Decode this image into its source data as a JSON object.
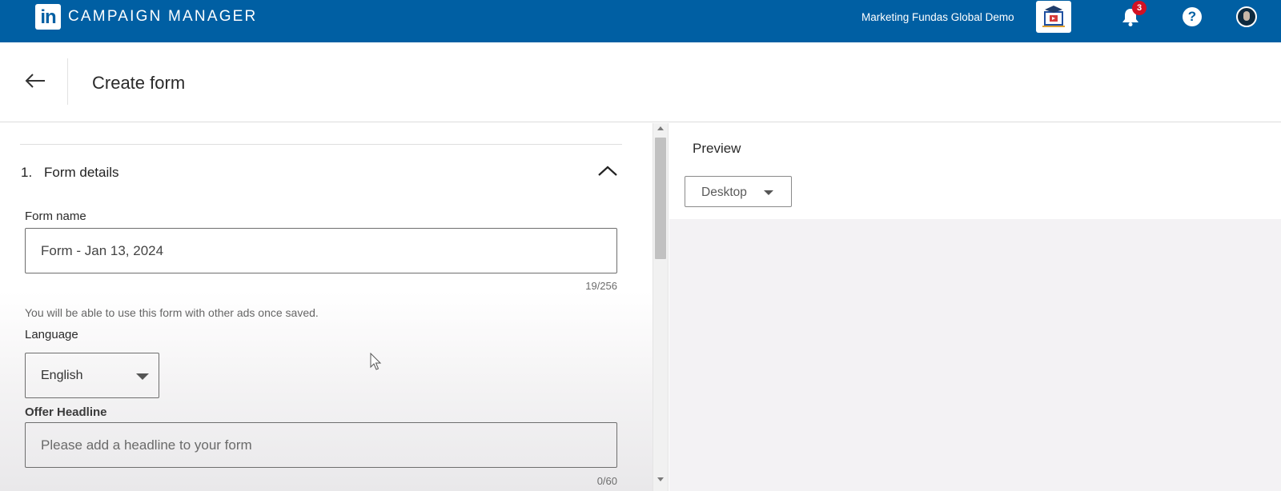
{
  "topbar": {
    "logo_text": "in",
    "brand": "CAMPAIGN MANAGER",
    "account_name": "Marketing Fundas Global Demo",
    "notification_count": "3",
    "help_glyph": "?",
    "brand_color": "#005fa3",
    "badge_color": "#d11124"
  },
  "header": {
    "title": "Create form"
  },
  "form": {
    "section_number": "1.",
    "section_title": "Form details",
    "form_name": {
      "label": "Form name",
      "value": "Form - Jan 13, 2024",
      "counter": "19/256"
    },
    "hint": "You will be able to use this form with other ads once saved.",
    "language": {
      "label": "Language",
      "value": "English"
    },
    "offer_headline": {
      "label": "Offer Headline",
      "placeholder": "Please add a headline to your form",
      "counter": "0/60"
    }
  },
  "preview": {
    "title": "Preview",
    "device": "Desktop"
  },
  "icons": {
    "back": "arrow-left-icon",
    "toggle": "chevron-up-icon",
    "notifications": "bell-icon",
    "help": "help-icon",
    "dropdown": "caret-down-icon"
  }
}
